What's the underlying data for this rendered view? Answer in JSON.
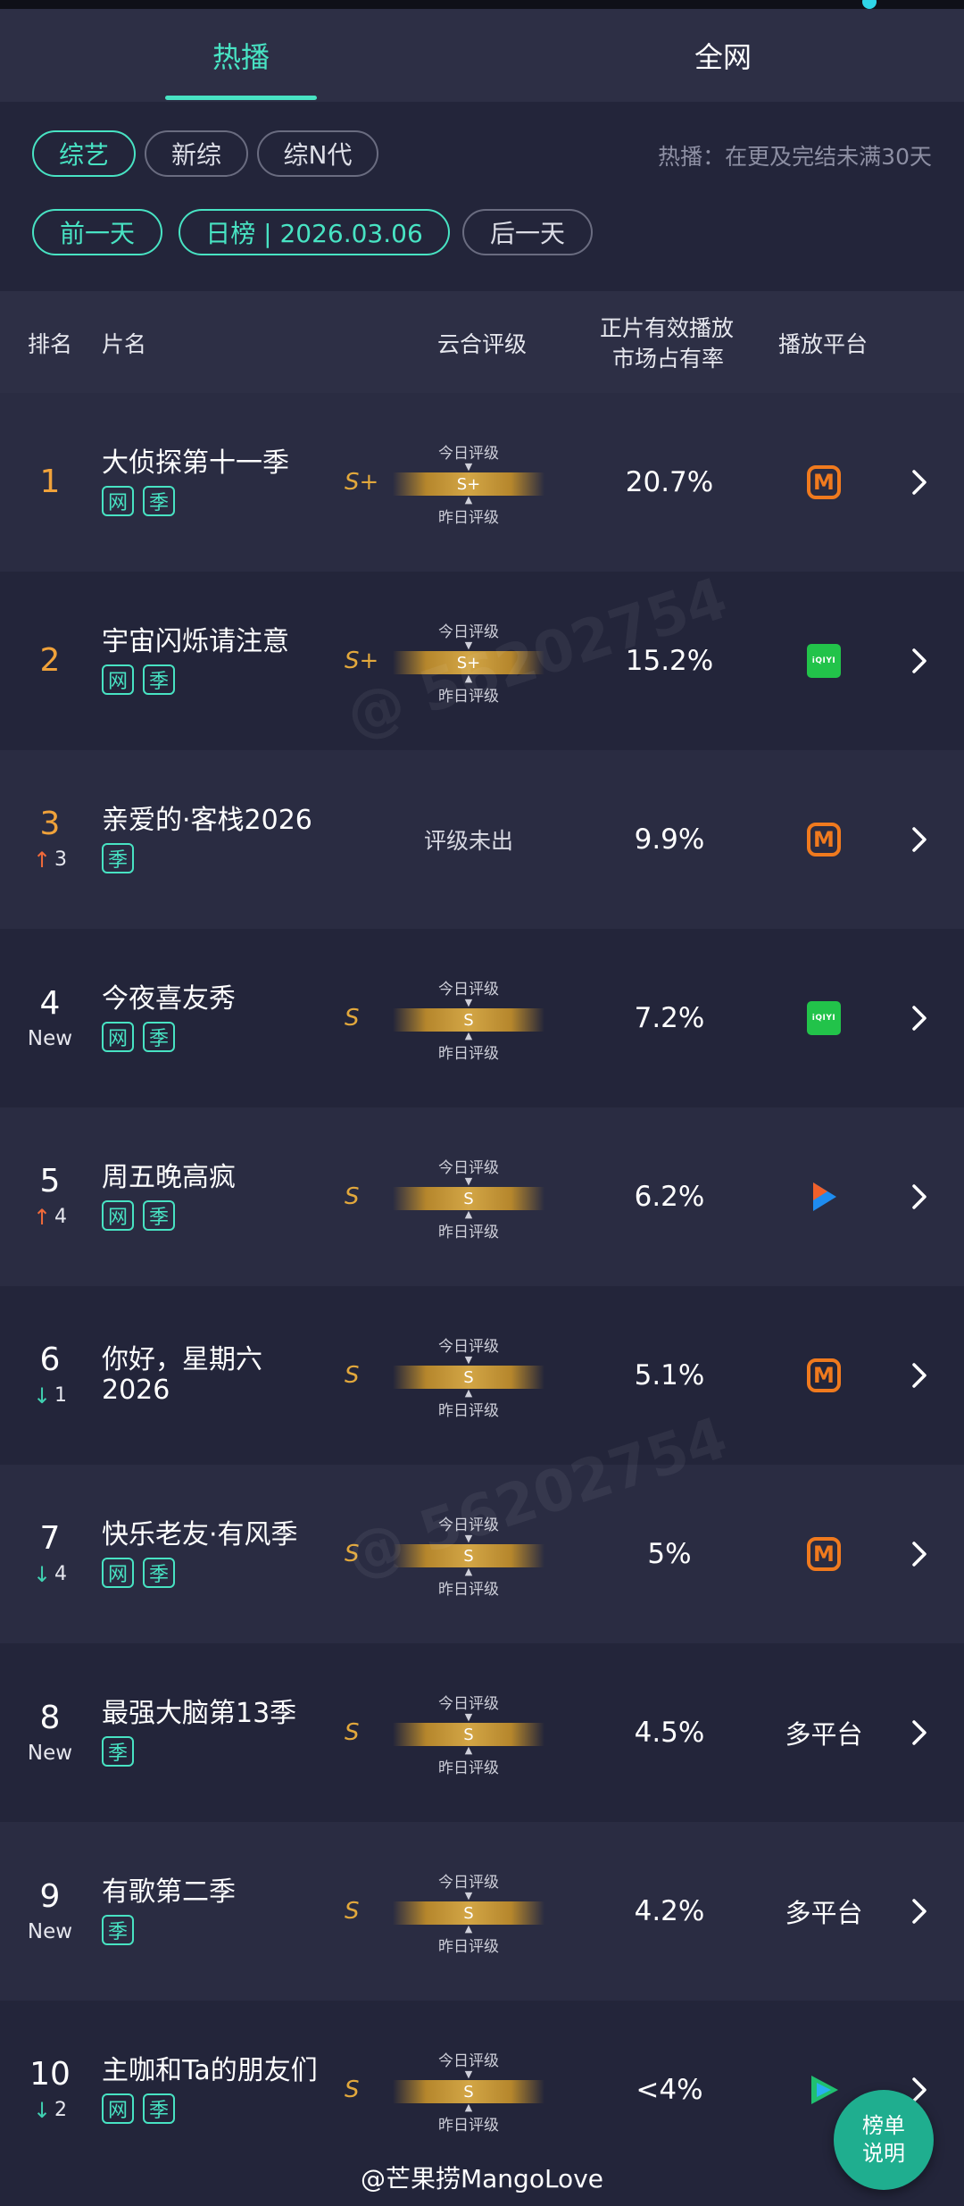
{
  "tabs": [
    {
      "label": "热播",
      "active": true
    },
    {
      "label": "全网",
      "active": false
    }
  ],
  "filters": {
    "category_chips": [
      "综艺",
      "新综",
      "综N代"
    ],
    "active_category": "综艺",
    "hint": "热播：在更及完结未满30天",
    "prev_day": "前一天",
    "date_label": "日榜 | 2026.03.06",
    "next_day": "后一天"
  },
  "table_header": {
    "rank": "排名",
    "title": "片名",
    "rating": "云合评级",
    "share_line1": "正片有效播放",
    "share_line2": "市场占有率",
    "platform": "播放平台"
  },
  "rating_labels": {
    "today": "今日评级",
    "yesterday": "昨日评级",
    "none": "评级未出"
  },
  "rows": [
    {
      "rank": "1",
      "change": "",
      "change_dir": "",
      "title": "大侦探第十一季",
      "tags": [
        "网",
        "季"
      ],
      "grade": "S+",
      "today": "S+",
      "share": "20.7%",
      "platform": "mango"
    },
    {
      "rank": "2",
      "change": "",
      "change_dir": "",
      "title": "宇宙闪烁请注意",
      "tags": [
        "网",
        "季"
      ],
      "grade": "S+",
      "today": "S+",
      "share": "15.2%",
      "platform": "iqiyi"
    },
    {
      "rank": "3",
      "change": "3",
      "change_dir": "up",
      "title": "亲爱的·客栈2026",
      "tags": [
        "季"
      ],
      "grade": "",
      "today": "",
      "share": "9.9%",
      "platform": "mango"
    },
    {
      "rank": "4",
      "change": "New",
      "change_dir": "new",
      "title": "今夜喜友秀",
      "tags": [
        "网",
        "季"
      ],
      "grade": "S",
      "today": "S",
      "share": "7.2%",
      "platform": "iqiyi"
    },
    {
      "rank": "5",
      "change": "4",
      "change_dir": "up",
      "title": "周五晚高疯",
      "tags": [
        "网",
        "季"
      ],
      "grade": "S",
      "today": "S",
      "share": "6.2%",
      "platform": "youku"
    },
    {
      "rank": "6",
      "change": "1",
      "change_dir": "down",
      "title": "你好，星期六\n2026",
      "tags": [],
      "grade": "S",
      "today": "S",
      "share": "5.1%",
      "platform": "mango"
    },
    {
      "rank": "7",
      "change": "4",
      "change_dir": "down",
      "title": "快乐老友·有风季",
      "tags": [
        "网",
        "季"
      ],
      "grade": "S",
      "today": "S",
      "share": "5%",
      "platform": "mango"
    },
    {
      "rank": "8",
      "change": "New",
      "change_dir": "new",
      "title": "最强大脑第13季",
      "tags": [
        "季"
      ],
      "grade": "S",
      "today": "S",
      "share": "4.5%",
      "platform": "多平台"
    },
    {
      "rank": "9",
      "change": "New",
      "change_dir": "new",
      "title": "有歌第二季",
      "tags": [
        "季"
      ],
      "grade": "S",
      "today": "S",
      "share": "4.2%",
      "platform": "多平台"
    },
    {
      "rank": "10",
      "change": "2",
      "change_dir": "down",
      "title": "主咖和Ta的朋友们",
      "tags": [
        "网",
        "季"
      ],
      "grade": "S",
      "today": "S",
      "share": "<4%",
      "platform": "tencent"
    }
  ],
  "platform_icons": {
    "mango": "mango-tv-icon",
    "iqiyi": "iqiyi-icon",
    "youku": "youku-icon",
    "tencent": "tencent-video-icon"
  },
  "iqiyi_text": "iQIYI",
  "mango_glyph": "M",
  "fab": {
    "line1": "榜单",
    "line2": "说明"
  },
  "credit": "@芒果捞MangoLove",
  "colors": {
    "accent": "#48e3c3",
    "gold": "#d3a646",
    "rank_gold": "#f0a23a",
    "up": "#f06a3a",
    "down": "#3fd0b0"
  }
}
